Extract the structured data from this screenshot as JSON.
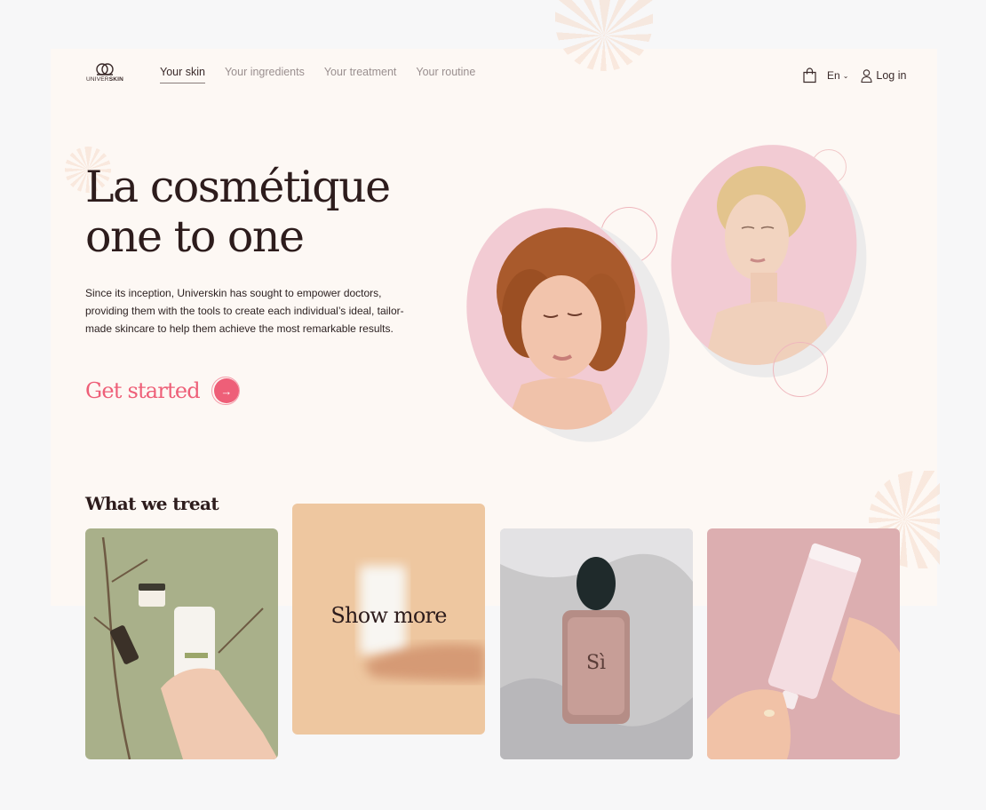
{
  "brand": {
    "logo_text_light": "UNIVER",
    "logo_text_bold": "SKIN"
  },
  "nav": {
    "items": [
      {
        "label": "Your skin",
        "active": true
      },
      {
        "label": "Your ingredients",
        "active": false
      },
      {
        "label": "Your treatment",
        "active": false
      },
      {
        "label": "Your routine",
        "active": false
      }
    ]
  },
  "header": {
    "cart_icon": "shopping-bag-icon",
    "language": "En",
    "language_chevron": "chevron-down-icon",
    "login_label": "Log in",
    "login_icon": "user-icon"
  },
  "hero": {
    "title_line1": "La cosmétique",
    "title_line2": "one to one",
    "description": "Since its inception, Universkin has sought to empower doctors, providing them with the tools to create each individual’s ideal, tailor-made skincare to help them achieve the most remarkable results.",
    "cta_label": "Get started",
    "cta_icon": "arrow-right-icon"
  },
  "treat": {
    "title": "What we treat",
    "cards": [
      {
        "name": "skincare-products-olive"
      },
      {
        "name": "show-more",
        "label": "Show more"
      },
      {
        "name": "perfume-bottle"
      },
      {
        "name": "repair-cream-tube"
      }
    ]
  },
  "colors": {
    "accent": "#ee5f78",
    "page_background": "#fdf8f4",
    "text_dark": "#2d1c1c",
    "pill_pink": "#f2cbd3"
  }
}
